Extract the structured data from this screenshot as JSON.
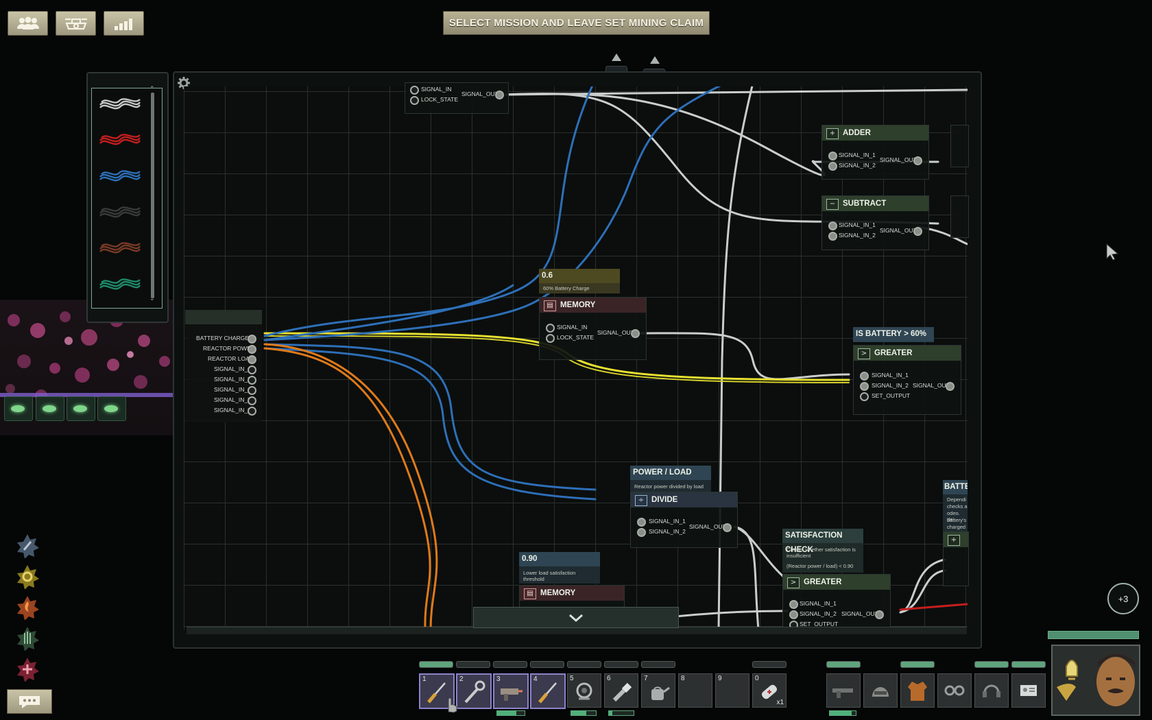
{
  "objective": "SELECT MISSION AND LEAVE SET MINING CLAIM",
  "top_buttons": [
    {
      "icon": "crew-icon"
    },
    {
      "icon": "submarine-icon"
    },
    {
      "icon": "statistics-icon"
    }
  ],
  "wire_palette": [
    {
      "color": "#c8c8c8",
      "name": "gray-wire-icon"
    },
    {
      "color": "#c41e1e",
      "name": "red-wire-icon"
    },
    {
      "color": "#2e6fb8",
      "name": "blue-wire-icon"
    },
    {
      "color": "#2a2a2a",
      "name": "black-wire-icon"
    },
    {
      "color": "#7a3a26",
      "name": "brown-wire-icon"
    },
    {
      "color": "#1f8a6a",
      "name": "green-wire-icon"
    }
  ],
  "io_pins": [
    "BATTERY CHARGE %",
    "REACTOR POWER",
    "REACTOR LOAD",
    "SIGNAL_IN_4",
    "SIGNAL_IN_5",
    "SIGNAL_IN_6",
    "SIGNAL_IN_7",
    "SIGNAL_IN_8"
  ],
  "top_memory": {
    "pin1": "SIGNAL_IN",
    "pin2": "LOCK_STATE",
    "out": "SIGNAL_OUT"
  },
  "adder": {
    "title": "ADDER",
    "in1": "SIGNAL_IN_1",
    "in2": "SIGNAL_IN_2",
    "out": "SIGNAL_OUT"
  },
  "subtract": {
    "title": "SUBTRACT",
    "in1": "SIGNAL_IN_1",
    "in2": "SIGNAL_IN_2",
    "out": "SIGNAL_OUT"
  },
  "memory1": {
    "label": "0.6",
    "desc": "60% Battery Charge",
    "title": "MEMORY",
    "in1": "SIGNAL_IN",
    "in2": "LOCK_STATE",
    "out": "SIGNAL_OUT"
  },
  "greater1": {
    "label": "IS BATTERY > 60%",
    "title": "GREATER",
    "in1": "SIGNAL_IN_1",
    "in2": "SIGNAL_IN_2",
    "in3": "SET_OUTPUT",
    "out": "SIGNAL_OUT"
  },
  "divide": {
    "label": "POWER / LOAD",
    "desc": "Reactor power divided by load",
    "title": "DIVIDE",
    "in1": "SIGNAL_IN_1",
    "in2": "SIGNAL_IN_2",
    "out": "SIGNAL_OUT"
  },
  "memory2": {
    "label": "0.90",
    "desc1": "Lower load satisfaction",
    "desc2": "threshold",
    "title": "MEMORY"
  },
  "greater2": {
    "label": "SATISFACTION CHECK",
    "desc1": "Checks whether satisfaction is",
    "desc2": "insufficient",
    "desc3": "(Reactor power / load) < 0.90",
    "title": "GREATER",
    "in1": "SIGNAL_IN_1",
    "in2": "SIGNAL_IN_2",
    "in3": "SET_OUTPUT",
    "out": "SIGNAL_OUT"
  },
  "partial_right": {
    "label": "BATTER",
    "desc": [
      "Dependi",
      "checks a",
      "odeo. dei",
      "battery's",
      "charged"
    ]
  },
  "hotbar": [
    {
      "num": "1",
      "icon": "screwdriver-icon",
      "selected": true
    },
    {
      "num": "2",
      "icon": "wrench-icon",
      "selected": true
    },
    {
      "num": "3",
      "icon": "welding-tool-icon",
      "selected": true
    },
    {
      "num": "4",
      "icon": "screwdriver-icon",
      "selected": true
    },
    {
      "num": "5",
      "icon": "diving-mask-icon",
      "selected": false
    },
    {
      "num": "6",
      "icon": "flashlight-icon",
      "selected": false
    },
    {
      "num": "7",
      "icon": "watering-can-icon",
      "selected": false
    },
    {
      "num": "8",
      "icon": "",
      "selected": false
    },
    {
      "num": "9",
      "icon": "",
      "selected": false
    },
    {
      "num": "0",
      "icon": "bandage-icon",
      "selected": false,
      "qty": "x1"
    }
  ],
  "equipment": [
    "rifle-icon",
    "helmet-icon",
    "jacket-icon",
    "goggles-icon",
    "headset-icon",
    "id-card-icon"
  ],
  "notification_count": "+3",
  "skills": [
    "skill-weapons-icon",
    "skill-mechanical-icon",
    "skill-electrical-icon",
    "skill-helm-icon",
    "skill-medical-icon"
  ]
}
